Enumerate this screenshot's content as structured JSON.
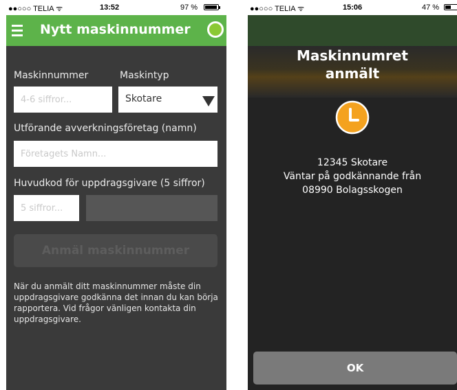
{
  "left": {
    "status": {
      "carrier": "●●○○○ TELIA ᯤ",
      "time": "13:52",
      "battery": "97 %",
      "battery_level": 0.97
    },
    "header": {
      "title": "Nytt maskinnummer",
      "menu_icon": "hamburger-menu-icon",
      "status_icon": "green-status-dot-icon",
      "accent": "#5db34a"
    },
    "form": {
      "machine_number_label": "Maskinnummer",
      "machine_number_placeholder": "4-6 siffror...",
      "machine_type_label": "Maskintyp",
      "machine_type_value": "Skotare",
      "company_label": "Utförande avverkningsföretag (namn)",
      "company_placeholder": "Företagets Namn...",
      "client_code_label": "Huvudkod för uppdragsgivare (5 siffror)",
      "client_code_placeholder": "5 siffror...",
      "submit_label": "Anmäl maskinnummer"
    },
    "info_text": "När du anmält ditt maskinnummer måste din uppdragsgivare godkänna det innan du kan börja rapportera. Vid frågor vänligen kontakta din uppdragsgivare."
  },
  "right": {
    "status": {
      "carrier": "●●○○○ TELIA ᯤ",
      "time": "15:06",
      "battery": "47 %",
      "battery_level": 0.47
    },
    "modal": {
      "title_line1": "Maskinnumret",
      "title_line2": "anmält",
      "icon": "clock-icon",
      "icon_color": "#f4a21f",
      "line1": "12345 Skotare",
      "line2": "Väntar på godkännande från",
      "line3": "08990 Bolagsskogen",
      "ok_label": "OK"
    }
  }
}
